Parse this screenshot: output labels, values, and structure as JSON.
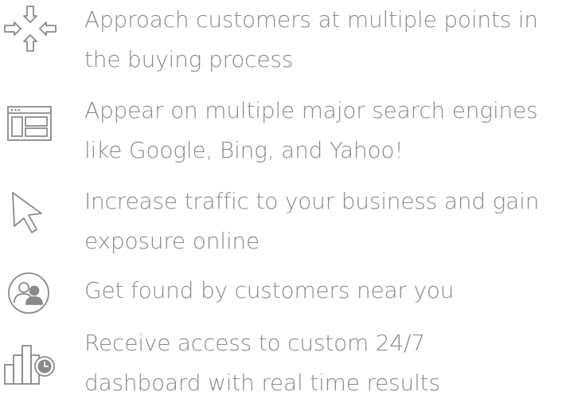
{
  "features": [
    {
      "icon": "converge-arrows-icon",
      "lines": [
        "Approach customers at multiple points in",
        "the buying process"
      ]
    },
    {
      "icon": "browser-layout-icon",
      "lines": [
        "Appear on multiple major search engines",
        "like Google, Bing, and Yahoo!"
      ]
    },
    {
      "icon": "cursor-arrow-icon",
      "lines": [
        "Increase traffic to your business and gain",
        "exposure online"
      ]
    },
    {
      "icon": "people-circle-icon",
      "lines": [
        "Get found by customers near you"
      ]
    },
    {
      "icon": "bar-chart-clock-icon",
      "lines": [
        "Receive access to custom 24/7",
        "dashboard with real time results"
      ]
    }
  ],
  "colors": {
    "text": "#8a8a8a",
    "icon": "#8a8a8a",
    "background": "#ffffff"
  }
}
